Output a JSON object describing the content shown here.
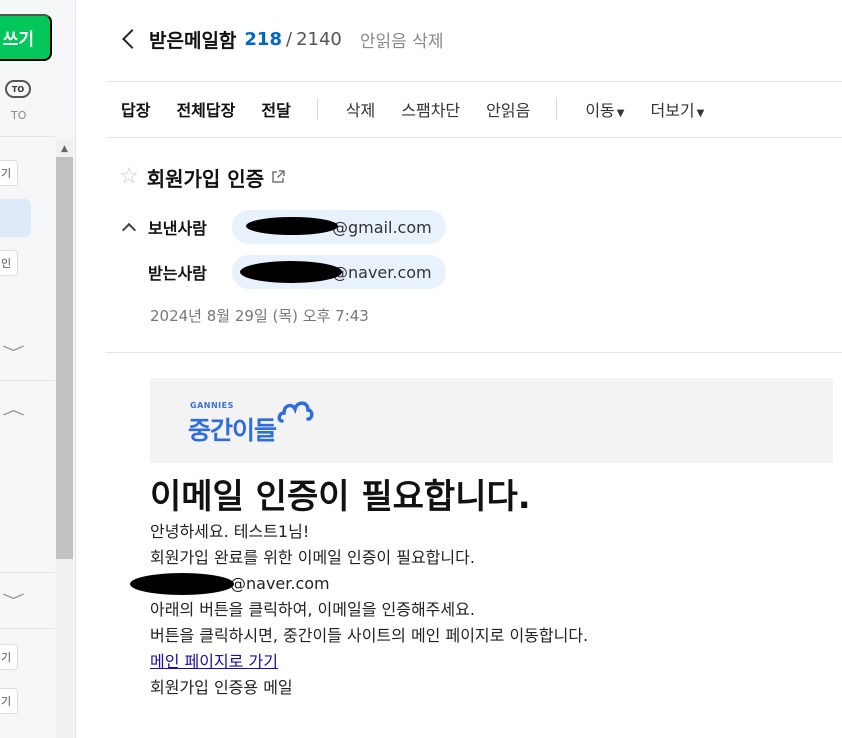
{
  "sidebar": {
    "compose_label": "쓰기",
    "to_badge": "TO",
    "to_label": "TO",
    "pill_1": "기",
    "pill_2": "인",
    "pill_3": "기",
    "pill_4": "기"
  },
  "header": {
    "folder": "받은메일함",
    "unread": "218",
    "separator": "/",
    "total": "2140",
    "delete_unread": "안읽음 삭제"
  },
  "toolbar": {
    "reply": "답장",
    "reply_all": "전체답장",
    "forward": "전달",
    "delete": "삭제",
    "block_spam": "스팸차단",
    "mark_unread": "안읽음",
    "move": "이동",
    "more": "더보기"
  },
  "message": {
    "subject": "회원가입 인증",
    "sender_label": "보낸사람",
    "sender_email": "@gmail.com",
    "recipient_label": "받는사람",
    "recipient_email": "@naver.com",
    "date": "2024년 8월 29일 (목) 오후 7:43"
  },
  "body": {
    "logo_sub": "GANNIES",
    "logo_main": "중간이들",
    "headline": "이메일 인증이 필요합니다.",
    "greeting": "안녕하세요. 테스트1님!",
    "line_1": "회원가입 완료를 위한 이메일 인증이 필요합니다.",
    "email": "@naver.com",
    "line_2": "아래의 버튼을 클릭하여, 이메일을 인증해주세요.",
    "line_3": "버튼을 클릭하시면, 중간이들 사이트의 메인 페이지로 이동합니다.",
    "link": "메인 페이지로 가기",
    "footer": "회원가입 인증용 메일"
  },
  "colors": {
    "accent_green": "#03c75a",
    "unread_blue": "#0068c3",
    "chip_bg": "#e8f2fd",
    "logo_blue": "#2f6ce0"
  },
  "icons": [
    "back-chevron-icon",
    "star-icon",
    "external-link-icon",
    "collapse-chevron-icon",
    "caret-down-icon",
    "scroll-up-icon"
  ]
}
